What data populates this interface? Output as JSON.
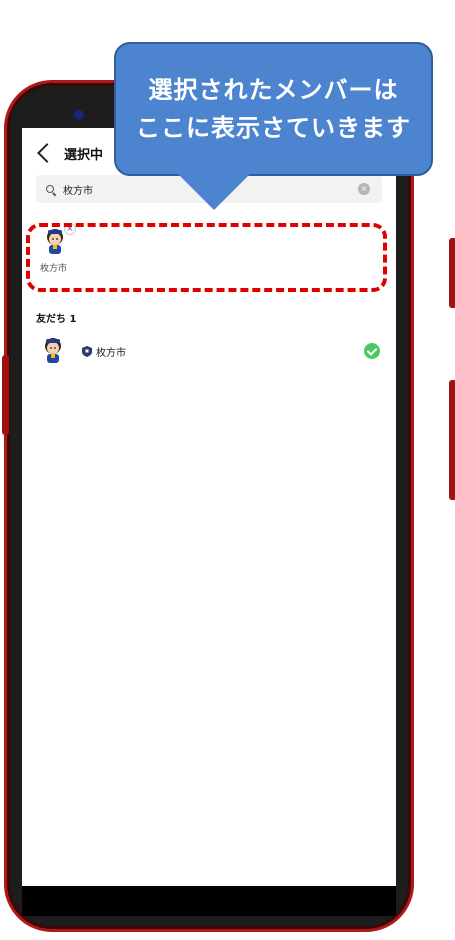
{
  "callout": {
    "line1": "選択されたメンバーは",
    "line2": "ここに表示さていきます"
  },
  "header": {
    "title": "選択中"
  },
  "search": {
    "value": "枚方市"
  },
  "selected": {
    "members": [
      {
        "name": "枚方市"
      }
    ]
  },
  "friends": {
    "section_title": "友だち 1",
    "items": [
      {
        "name": "枚方市",
        "checked": true
      }
    ]
  },
  "colors": {
    "highlight": "#e00000",
    "callout": "#4d84cf",
    "check": "#4cc764",
    "phone_frame": "#b01818"
  }
}
